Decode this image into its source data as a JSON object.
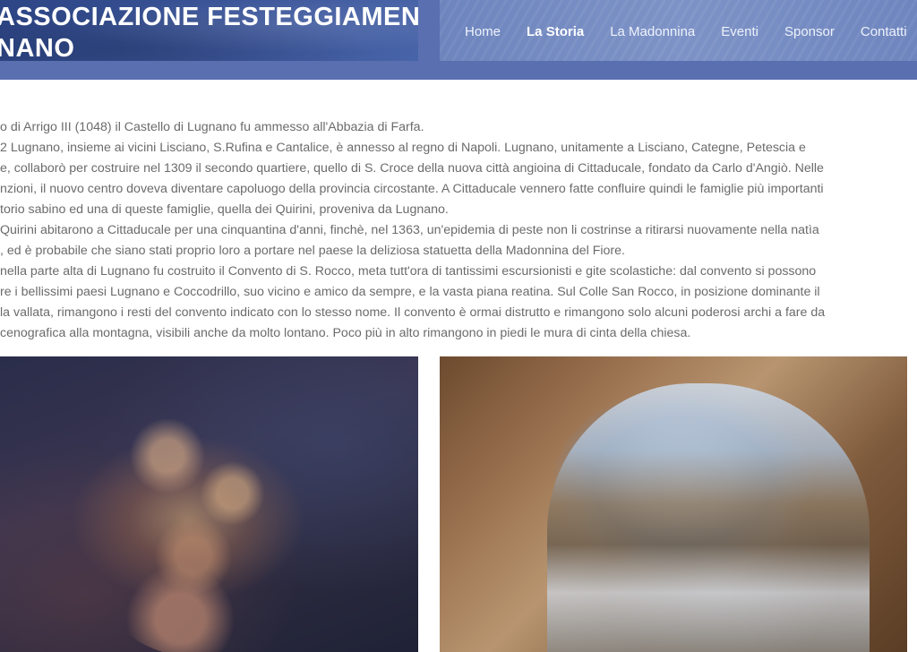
{
  "header": {
    "logo_line1": "ASSOCIAZIONE FESTEGGIAMENTI",
    "logo_line2": "NANO",
    "nav": [
      {
        "label": "Home",
        "active": false
      },
      {
        "label": "La Storia",
        "active": true
      },
      {
        "label": "La Madonnina",
        "active": false
      },
      {
        "label": "Eventi",
        "active": false
      },
      {
        "label": "Sponsor",
        "active": false
      },
      {
        "label": "Contatti",
        "active": false
      }
    ]
  },
  "content": {
    "p1": [
      "o di Arrigo III (1048) il Castello di Lugnano fu ammesso all'Abbazia di Farfa."
    ],
    "p2": [
      "2 Lugnano, insieme ai vicini Lisciano, S.Rufina e Cantalice, è annesso al regno di Napoli. Lugnano, unitamente a Lisciano, Categne, Petescia e",
      "e, collaborò per costruire nel 1309 il secondo quartiere, quello di S. Croce della nuova città angioina di Cittaducale, fondato da Carlo d'Angiò. Nelle",
      "nzioni, il nuovo centro doveva diventare capoluogo della provincia circostante. A Cittaducale vennero fatte confluire quindi le famiglie più importanti",
      "torio sabino ed una di queste famiglie, quella dei Quirini, proveniva da Lugnano."
    ],
    "p3": [
      "Quirini abitarono a Cittaducale per una cinquantina d'anni, finchè, nel 1363, un'epidemia di peste non li costrinse a ritirarsi nuovamente nella natìa",
      ", ed è probabile che siano stati proprio loro a portare nel paese la deliziosa statuetta della Madonnina del Fiore."
    ],
    "p4": [
      "nella parte alta di Lugnano fu costruito il Convento di S. Rocco, meta tutt'ora di tantissimi escursionisti e gite scolastiche: dal convento si possono",
      "re i bellissimi paesi Lugnano e Coccodrillo, suo vicino e amico da sempre, e la vasta piana reatina. Sul Colle San Rocco, in posizione dominante il",
      " la vallata, rimangono i resti del convento indicato con lo stesso nome. Il convento è ormai distrutto e rimangono solo alcuni poderosi archi a fare da",
      "cenografica alla montagna, visibili anche da molto lontano. Poco più in alto rimangono in piedi le mura di cinta della chiesa."
    ]
  },
  "colors": {
    "header_bg": "#5a6fb0",
    "logo_bg": "#2d4585",
    "nav_bg": "#7d93c7",
    "body_text": "#6b6b6b"
  }
}
